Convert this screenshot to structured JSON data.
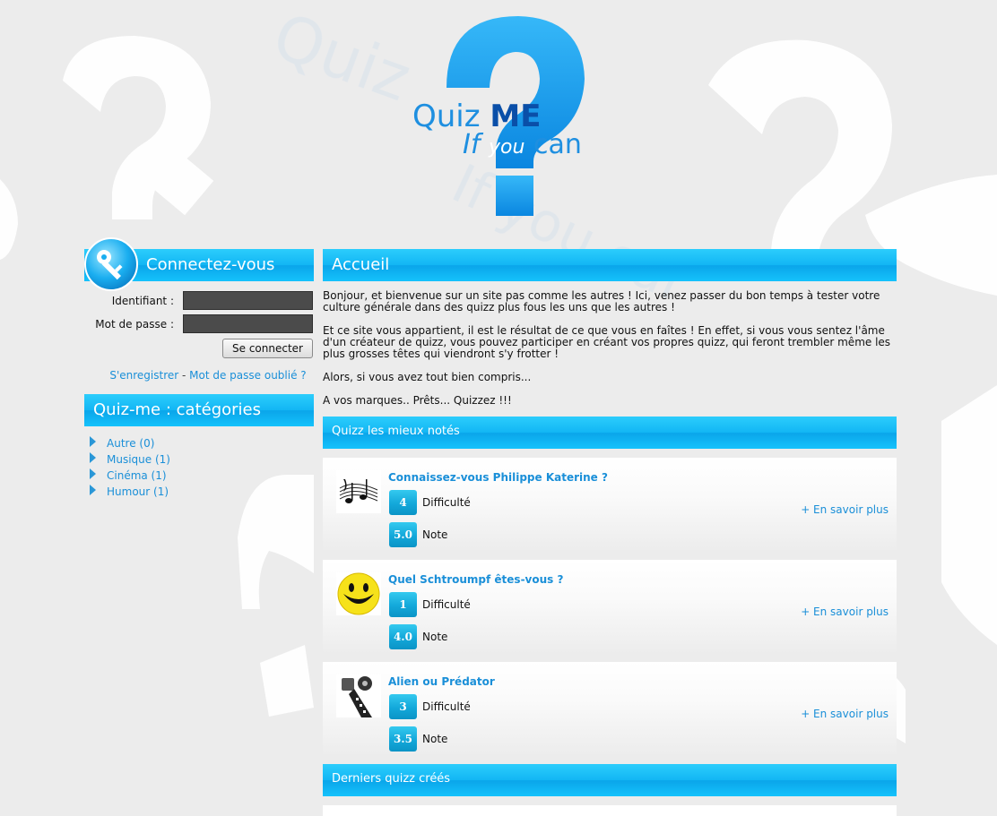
{
  "site": {
    "logo_word1": "Quiz",
    "logo_word2": "ME",
    "logo_tag_if": "If",
    "logo_tag_you": "you",
    "logo_tag_can": "can"
  },
  "login": {
    "title": "Connectez-vous",
    "identifiant_label": "Identifiant :",
    "password_label": "Mot de passe :",
    "identifiant_value": "",
    "password_value": "",
    "submit_label": "Se connecter",
    "register_link": "S'enregistrer",
    "separator": " - ",
    "forgot_link": "Mot de passe oublié ?"
  },
  "categories": {
    "title": "Quiz-me : catégories",
    "items": [
      {
        "label": "Autre (0)"
      },
      {
        "label": "Musique (1)"
      },
      {
        "label": "Cinéma (1)"
      },
      {
        "label": "Humour (1)"
      }
    ]
  },
  "main": {
    "title": "Accueil",
    "paragraphs": [
      "Bonjour, et bienvenue sur un site pas comme les autres ! Ici, venez passer du bon temps à tester votre culture générale dans des quizz plus fous les uns que les autres !",
      "Et ce site vous appartient, il est le résultat de ce que vous en faîtes ! En effet, si vous vous sentez l'âme d'un créateur de quizz, vous pouvez participer en créant vos propres quizz, qui feront trembler même les plus grosses têtes qui viendront s'y frotter !",
      "Alors, si vous avez tout bien compris...",
      "A vos marques.. Prêts... Quizzez !!!"
    ],
    "best_title": "Quizz les mieux notés",
    "last_title": "Derniers quizz créés",
    "difficulty_label": "Difficulté",
    "note_label": "Note",
    "more_label": "+ En savoir plus",
    "quizzes": [
      {
        "title": "Connaissez-vous Philippe Katerine ?",
        "difficulty": "4",
        "note": "5.0",
        "thumb_icon": "music-notes-icon"
      },
      {
        "title": "Quel Schtroumpf êtes-vous ?",
        "difficulty": "1",
        "note": "4.0",
        "thumb_icon": "smiley-icon"
      },
      {
        "title": "Alien ou Prédator",
        "difficulty": "3",
        "note": "3.5",
        "thumb_icon": "film-reel-icon"
      }
    ]
  },
  "colors": {
    "accent": "#12b6f4",
    "link": "#1a8fd8",
    "background": "#ececec"
  }
}
